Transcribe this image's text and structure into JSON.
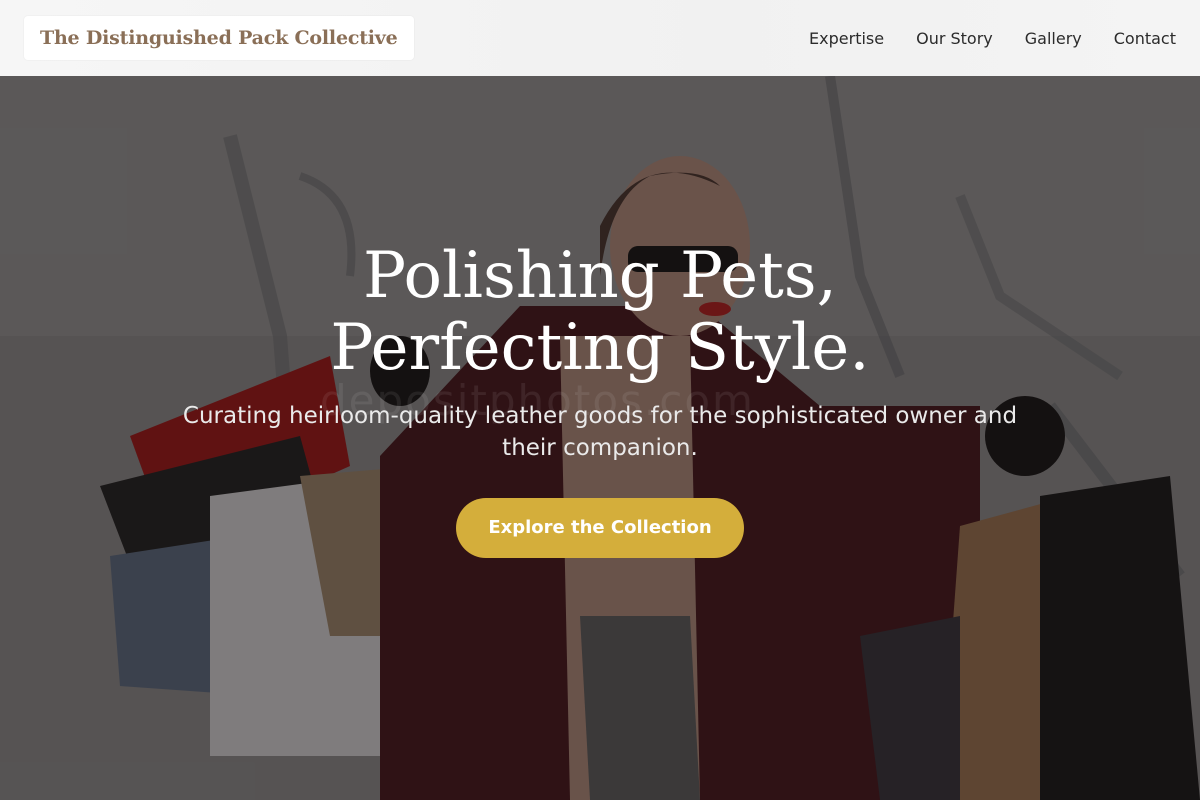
{
  "header": {
    "brand": "The Distinguished Pack Collective",
    "nav": [
      "Expertise",
      "Our Story",
      "Gallery",
      "Contact"
    ]
  },
  "hero": {
    "title": "Polishing Pets, Perfecting Style.",
    "subtitle": "Curating heirloom-quality leather goods for the sophisticated owner and their companion.",
    "cta": "Explore the Collection",
    "watermark": "depositphotos.com"
  },
  "colors": {
    "brand_text": "#8a6f57",
    "cta_background": "#d4ae3b",
    "header_background": "#f4f4f4"
  }
}
